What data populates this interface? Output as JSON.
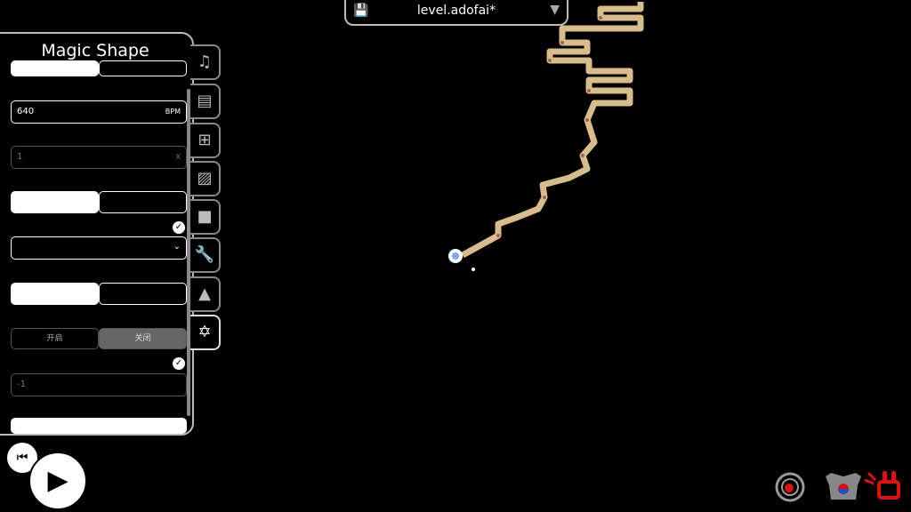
{
  "file": {
    "name": "level.adofai*",
    "icon": "save-icon",
    "dropdown_icon": "triangle-down-icon"
  },
  "panel": {
    "title": "Magic Shape",
    "bpm_value": "640",
    "bpm_unit": "BPM",
    "multiplier_value": "1",
    "multiplier_unit": "X",
    "toggle_on": "开启",
    "toggle_off": "关闭",
    "offset_value": "-1"
  },
  "tabs": [
    {
      "icon": "music-note-icon"
    },
    {
      "icon": "document-icon"
    },
    {
      "icon": "tiles-icon"
    },
    {
      "icon": "image-icon"
    },
    {
      "icon": "camera-icon"
    },
    {
      "icon": "wrench-icon"
    },
    {
      "icon": "bell-tree-icon"
    },
    {
      "icon": "star-of-david-icon",
      "active": true
    }
  ],
  "controls": {
    "rewind_icon": "rewind-icon",
    "play_icon": "play-icon"
  },
  "bottom_icons": [
    "target-icon",
    "armor-icon",
    "red-gift-icon"
  ],
  "colors": {
    "track": "#d8bd8a",
    "accent_red": "#e01010"
  }
}
